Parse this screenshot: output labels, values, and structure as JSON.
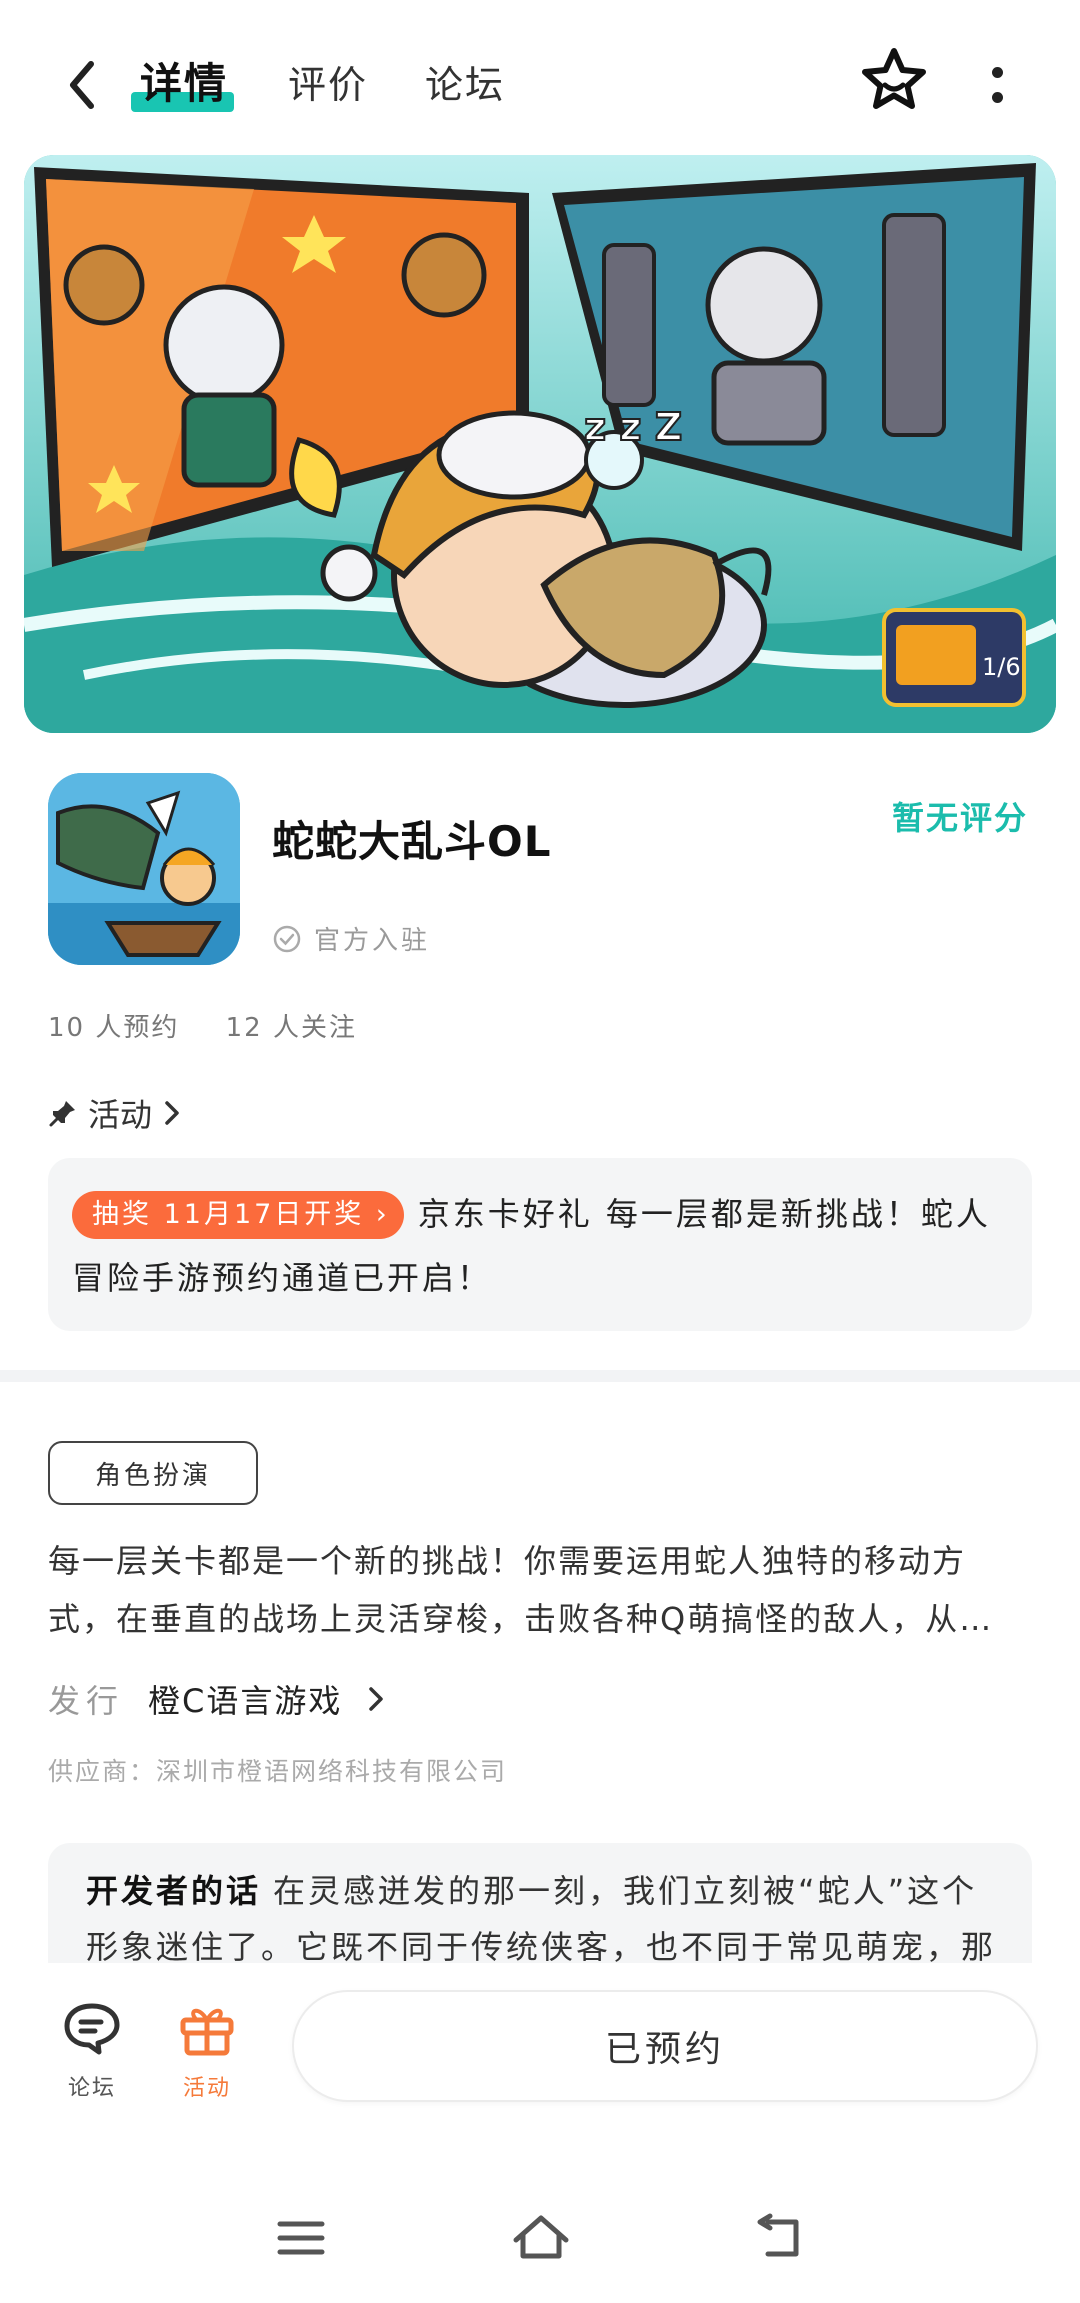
{
  "header": {
    "tabs": [
      {
        "label": "详情",
        "active": true
      },
      {
        "label": "评价",
        "active": false
      },
      {
        "label": "论坛",
        "active": false
      }
    ],
    "accent": "#19c5b2"
  },
  "app": {
    "name": "蛇蛇大乱斗OL",
    "rating": "暂无评分",
    "official": "官方入驻",
    "reservations": "10 人预约",
    "followers": "12 人关注"
  },
  "activity": {
    "heading": "活动",
    "badge": "抽奖 11月17日开奖",
    "text": "京东卡好礼 每一层都是新挑战！蛇人冒险手游预约通道已开启！"
  },
  "info": {
    "genre": "角色扮演",
    "desc_line1": "每一层关卡都是一个新的挑战！你需要运用蛇人独特的移动方",
    "desc_line2": "式，在垂直的战场上灵活穿梭，击败各种Q萌搞怪的敌人，从呆萌的小怪到强大的首领",
    "publisher_label": "发行",
    "publisher_name": "橙C语言游戏",
    "supplier": "供应商：深圳市橙语网络科技有限公司"
  },
  "developer": {
    "title": "开发者的话",
    "text": "在灵感迸发的那一刻，我们立刻被“蛇人”这个形象迷住了。它既不同于传统侠客，也不同于常见萌宠，那"
  },
  "bottom": {
    "forum_label": "论坛",
    "activity_label": "活动",
    "reserved_label": "已预约",
    "activity_color": "#f57a3a"
  },
  "banner": {
    "logo_text": "1/6"
  }
}
